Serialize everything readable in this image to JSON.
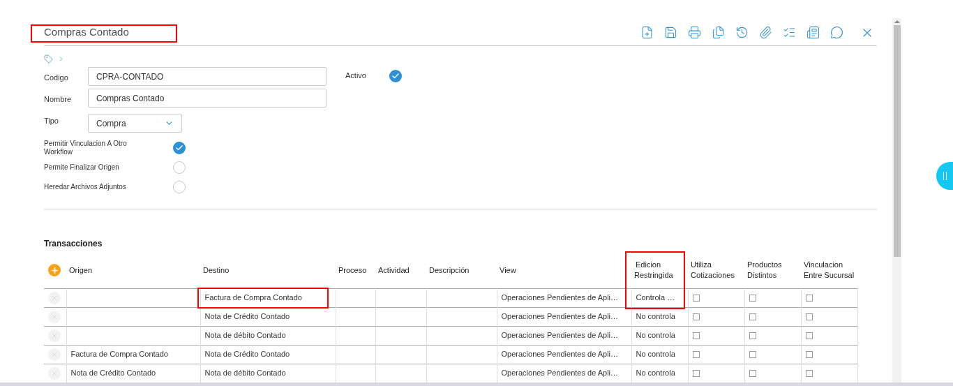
{
  "title": {
    "text": "Compras Contado",
    "highlighted": true
  },
  "fields": [
    {
      "label": "Codigo",
      "kind": "text",
      "value": "CPRA-CONTADO"
    },
    {
      "label": "Nombre",
      "kind": "text",
      "value": "Compras Contado"
    },
    {
      "label": "Tipo",
      "kind": "select",
      "value": "Compra"
    }
  ],
  "activo": {
    "label": "Activo",
    "checked": true
  },
  "options": [
    {
      "label": "Permitir Vinculacion A Otro Workflow",
      "checked": true
    },
    {
      "label": "Permite Finalizar Origen",
      "checked": false
    },
    {
      "label": "Heredar Archivos Adjuntos",
      "checked": false
    }
  ],
  "transacciones": {
    "title": "Transacciones",
    "columns": [
      {
        "label": "Origen",
        "kind": "text",
        "highlighted": false
      },
      {
        "label": "Destino",
        "kind": "text",
        "highlighted": false
      },
      {
        "label": "Proceso",
        "kind": "text",
        "highlighted": false
      },
      {
        "label": "Actividad",
        "kind": "text",
        "highlighted": false
      },
      {
        "label": "Descripción",
        "kind": "text",
        "highlighted": false
      },
      {
        "label": "View",
        "kind": "text",
        "highlighted": false
      },
      {
        "label": "Edicion Restringida",
        "kind": "text",
        "highlighted": true
      },
      {
        "label": "Utiliza Cotizaciones",
        "kind": "check",
        "highlighted": false
      },
      {
        "label": "Productos Distintos",
        "kind": "check",
        "highlighted": false
      },
      {
        "label": "Vinculacion Entre Sucursal",
        "kind": "check",
        "highlighted": false
      }
    ],
    "rows": [
      {
        "cells": [
          {},
          {
            "text": "Factura de Compra Contado",
            "highlighted": true
          },
          {},
          {},
          {},
          {
            "text": "Operaciones Pendientes de Apli…"
          },
          {
            "text": "Controla …"
          },
          {
            "checked": false
          },
          {
            "checked": false
          },
          {
            "checked": false
          }
        ]
      },
      {
        "cells": [
          {},
          {
            "text": "Nota de Crédito Contado"
          },
          {},
          {},
          {},
          {
            "text": "Operaciones Pendientes de Apli…"
          },
          {
            "text": "No controla"
          },
          {
            "checked": false
          },
          {
            "checked": false
          },
          {
            "checked": false
          }
        ]
      },
      {
        "cells": [
          {},
          {
            "text": "Nota de débito Contado"
          },
          {},
          {},
          {},
          {
            "text": "Operaciones Pendientes de Apli…"
          },
          {
            "text": "No controla"
          },
          {
            "checked": false
          },
          {
            "checked": false
          },
          {
            "checked": false
          }
        ]
      },
      {
        "cells": [
          {
            "text": "Factura de Compra Contado"
          },
          {
            "text": "Nota de Crédito Contado"
          },
          {},
          {},
          {},
          {
            "text": "Operaciones Pendientes de Apli…"
          },
          {
            "text": "No controla"
          },
          {
            "checked": false
          },
          {
            "checked": false
          },
          {
            "checked": false
          }
        ]
      },
      {
        "cells": [
          {
            "text": "Nota de Crédito Contado"
          },
          {
            "text": "Nota de débito Contado"
          },
          {},
          {},
          {},
          {
            "text": "Operaciones Pendientes de Apli…"
          },
          {
            "text": "No controla"
          },
          {
            "checked": false
          },
          {
            "checked": false
          },
          {
            "checked": false
          }
        ]
      }
    ]
  }
}
